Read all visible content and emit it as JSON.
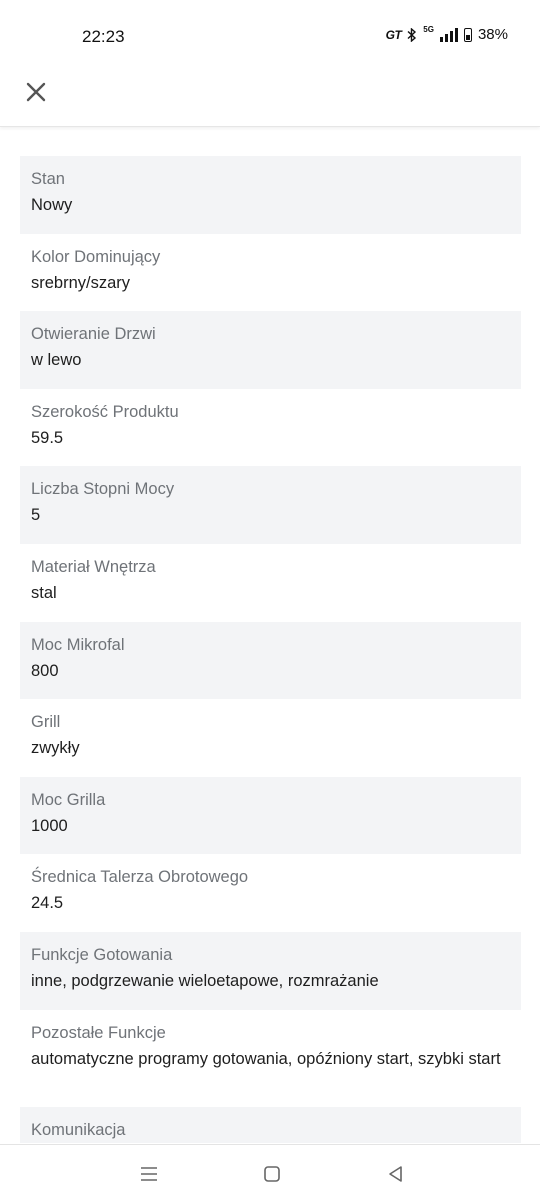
{
  "status_bar": {
    "time": "22:23",
    "gt_label": "GT",
    "network_label": "5G",
    "battery": "38%"
  },
  "header": {
    "close_icon": "close-icon"
  },
  "properties": [
    {
      "label": "Stan",
      "value": "Nowy"
    },
    {
      "label": "Kolor Dominujący",
      "value": "srebrny/szary"
    },
    {
      "label": "Otwieranie Drzwi",
      "value": "w lewo"
    },
    {
      "label": "Szerokość Produktu",
      "value": "59.5"
    },
    {
      "label": "Liczba Stopni Mocy",
      "value": "5"
    },
    {
      "label": "Materiał Wnętrza",
      "value": "stal"
    },
    {
      "label": "Moc Mikrofal",
      "value": "800"
    },
    {
      "label": "Grill",
      "value": "zwykły"
    },
    {
      "label": "Moc Grilla",
      "value": "1000"
    },
    {
      "label": "Średnica Talerza Obrotowego",
      "value": "24.5"
    },
    {
      "label": "Funkcje Gotowania",
      "value": "inne, podgrzewanie wieloetapowe, rozmrażanie"
    },
    {
      "label": "Pozostałe Funkcje",
      "value": "automatyczne programy gotowania, opóźniony start, szybki start"
    },
    {
      "label": "Komunikacja",
      "value": ""
    }
  ],
  "navbar": {
    "recents_icon": "menu-icon",
    "home_icon": "square-icon",
    "back_icon": "back-triangle-icon"
  }
}
